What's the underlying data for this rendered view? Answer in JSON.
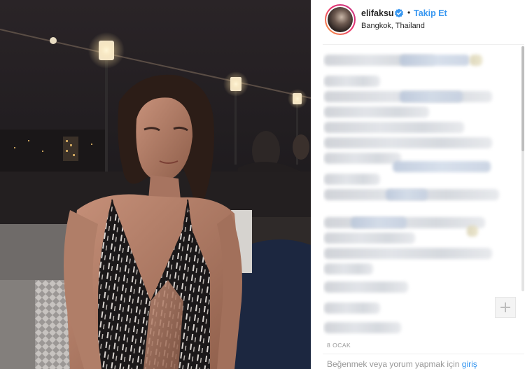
{
  "post": {
    "username": "elifaksu",
    "separator": "•",
    "follow_label": "Takip Et",
    "location": "Bangkok, Thailand",
    "date": "8 OCAK",
    "login_prompt": "Beğenmek veya yorum yapmak için",
    "login_link": "giriş"
  },
  "colors": {
    "link_blue": "#3897f0",
    "username": "#262626",
    "muted": "#999999"
  },
  "icons": {
    "verified": "verified-badge-icon",
    "add": "plus-icon"
  }
}
